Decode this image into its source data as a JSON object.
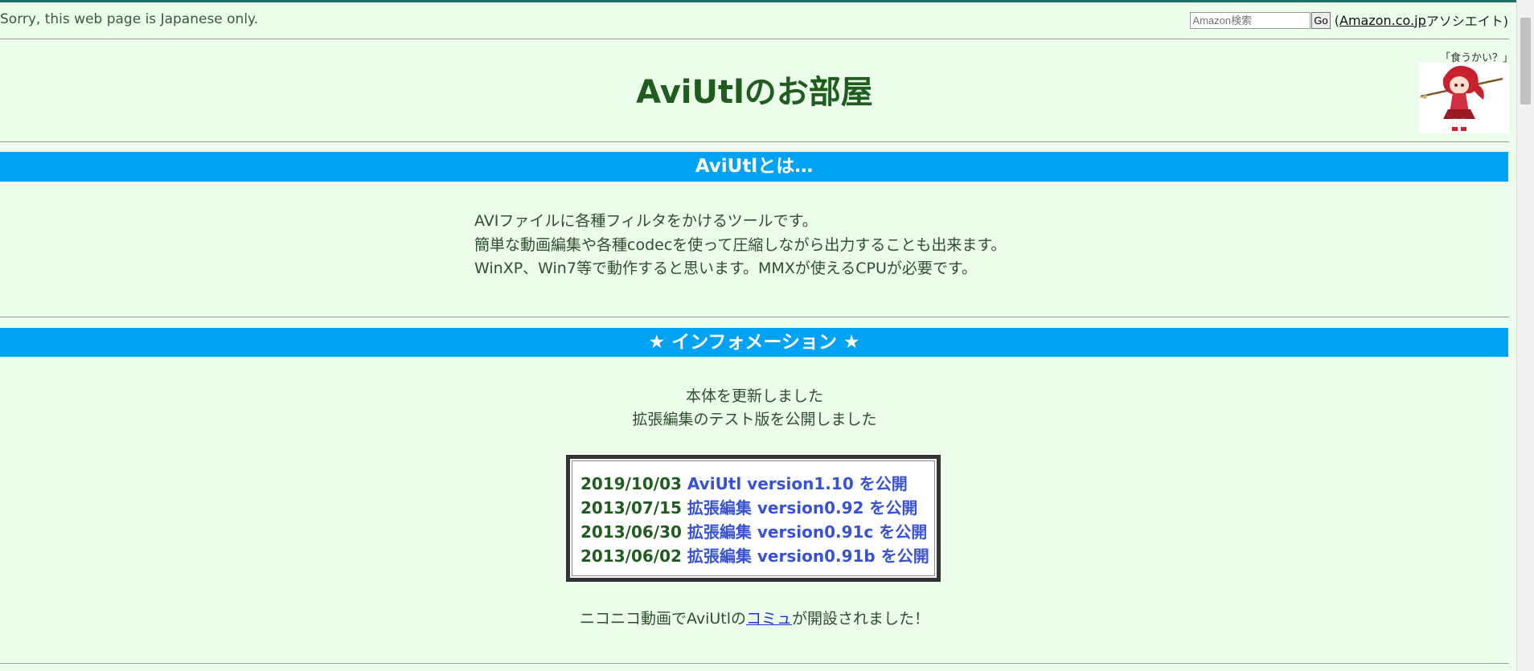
{
  "header": {
    "notice": "Sorry, this web page is Japanese only.",
    "search_placeholder": "Amazon検索",
    "go_label": "Go",
    "paren_open": "(",
    "amazon_link": "Amazon.co.jp",
    "associate_text": "アソシエイト)"
  },
  "title": "AviUtlのお部屋",
  "mascot": {
    "caption": "「食うかい？」",
    "icon": "anime-girl-with-spear-image"
  },
  "about": {
    "heading": "AviUtlとは…",
    "lines": [
      "AVIファイルに各種フィルタをかけるツールです。",
      "簡単な動画編集や各種codecを使って圧縮しながら出力することも出来ます。",
      "WinXP、Win7等で動作すると思います。MMXが使えるCPUが必要です。"
    ]
  },
  "info": {
    "heading": "★ インフォメーション ★",
    "lines": [
      "本体を更新しました",
      "拡張編集のテスト版を公開しました"
    ],
    "news": [
      {
        "date": "2019/10/03",
        "text": "AviUtl version1.10 を公開"
      },
      {
        "date": "2013/07/15",
        "text": "拡張編集 version0.92 を公開"
      },
      {
        "date": "2013/06/30",
        "text": "拡張編集 version0.91c を公開"
      },
      {
        "date": "2013/06/02",
        "text": "拡張編集 version0.91b を公開"
      }
    ],
    "niconico_prefix": "ニコニコ動画でAviUtlの",
    "niconico_link": "コミュ",
    "niconico_suffix": "が開設されました！"
  },
  "colors": {
    "background": "#ecfdec",
    "bar": "#00a2f3",
    "title": "#1f5d1f",
    "link": "#3752d6"
  }
}
